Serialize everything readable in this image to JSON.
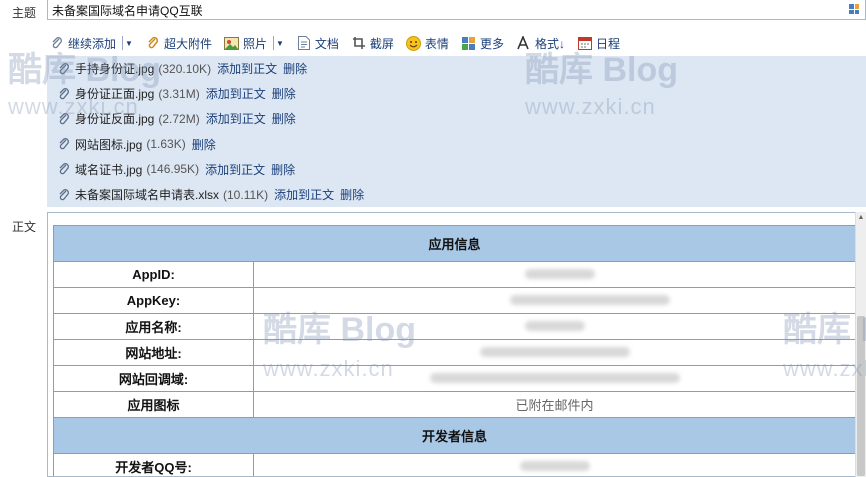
{
  "subject": {
    "label": "主题",
    "value": "未备案国际域名申请QQ互联"
  },
  "toolbar": {
    "continue_add": "继续添加",
    "super_attach": "超大附件",
    "photo": "照片",
    "document": "文档",
    "screenshot": "截屏",
    "emoji": "表情",
    "more": "更多",
    "format": "格式↓",
    "schedule": "日程"
  },
  "attachments": [
    {
      "name": "手持身份证.jpg",
      "size": "(320.10K)"
    },
    {
      "name": "身份证正面.jpg",
      "size": "(3.31M)"
    },
    {
      "name": "身份证反面.jpg",
      "size": "(2.72M)"
    },
    {
      "name": "网站图标.jpg",
      "size": "(1.63K)"
    },
    {
      "name": "域名证书.jpg",
      "size": "(146.95K)"
    },
    {
      "name": "未备案国际域名申请表.xlsx",
      "size": "(10.11K)"
    }
  ],
  "attachment_actions": {
    "insert": "添加到正文",
    "delete": "删除"
  },
  "body": {
    "label": "正文",
    "sections": [
      {
        "title": "应用信息",
        "rows": [
          {
            "key": "AppID:",
            "value": ""
          },
          {
            "key": "AppKey:",
            "value": ""
          },
          {
            "key": "应用名称:",
            "value": ""
          },
          {
            "key": "网站地址:",
            "value": ""
          },
          {
            "key": "网站回调域:",
            "value": ""
          },
          {
            "key": "应用图标",
            "value": "已附在邮件内"
          }
        ]
      },
      {
        "title": "开发者信息",
        "rows": [
          {
            "key": "开发者QQ号:",
            "value": ""
          }
        ]
      }
    ]
  },
  "watermark": {
    "brand": "酷库 Blog",
    "url": "www.zxki.cn"
  },
  "colors": {
    "accent": "#1a3f7a",
    "attach_bg": "#dde7f3",
    "section_bg": "#a9c8e6"
  }
}
